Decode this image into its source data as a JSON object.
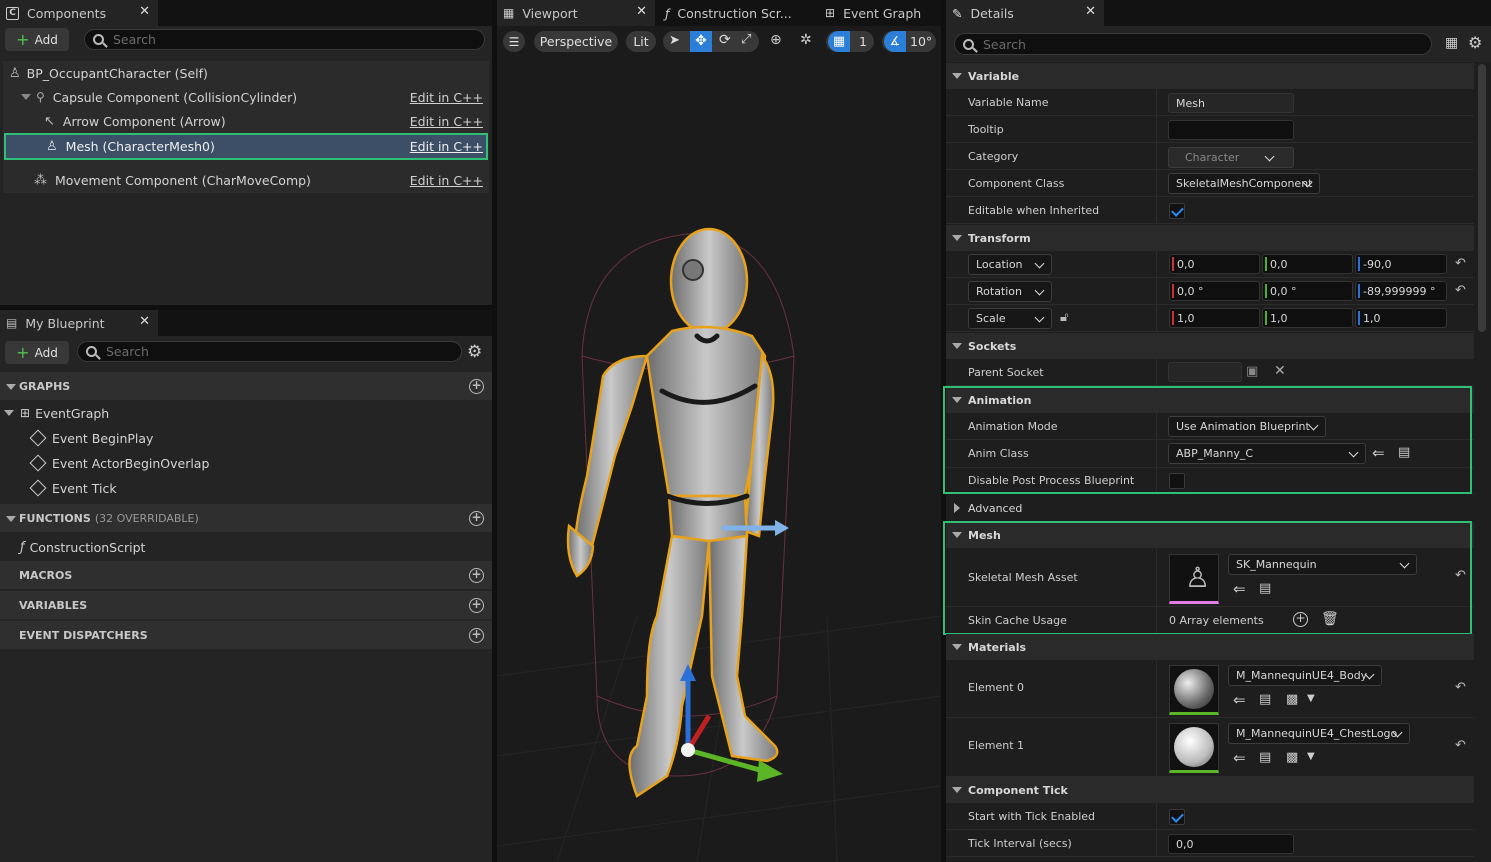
{
  "components_panel": {
    "tab_label": "Components",
    "add_label": "Add",
    "search_placeholder": "Search",
    "tree": [
      {
        "label": "BP_OccupantCharacter (Self)",
        "edit": ""
      },
      {
        "label": "Capsule Component (CollisionCylinder)",
        "edit": "Edit in C++"
      },
      {
        "label": "Arrow Component (Arrow)",
        "edit": "Edit in C++"
      },
      {
        "label": "Mesh (CharacterMesh0)",
        "edit": "Edit in C++"
      },
      {
        "label": "Movement Component (CharMoveComp)",
        "edit": "Edit in C++"
      }
    ]
  },
  "my_blueprint": {
    "tab_label": "My Blueprint",
    "add_label": "Add",
    "search_placeholder": "Search",
    "graphs_label": "GRAPHS",
    "event_graph": "EventGraph",
    "events": [
      "Event BeginPlay",
      "Event ActorBeginOverlap",
      "Event Tick"
    ],
    "functions_label": "FUNCTIONS",
    "functions_count": "(32 OVERRIDABLE)",
    "construction_script": "ConstructionScript",
    "macros_label": "MACROS",
    "variables_label": "VARIABLES",
    "dispatchers_label": "EVENT DISPATCHERS"
  },
  "center_tabs": {
    "viewport": "Viewport",
    "construction": "Construction Scr...",
    "event_graph": "Event Graph"
  },
  "viewport_toolbar": {
    "perspective": "Perspective",
    "lit": "Lit",
    "grid_value": "1",
    "angle_value": "10°"
  },
  "details": {
    "tab_label": "Details",
    "search_placeholder": "Search",
    "sections": {
      "variable": "Variable",
      "transform": "Transform",
      "sockets": "Sockets",
      "animation": "Animation",
      "advanced": "Advanced",
      "mesh": "Mesh",
      "materials": "Materials",
      "component_tick": "Component Tick"
    },
    "variable_name_label": "Variable Name",
    "variable_name_value": "Mesh",
    "tooltip_label": "Tooltip",
    "category_label": "Category",
    "category_value": "Character",
    "component_class_label": "Component Class",
    "component_class_value": "SkeletalMeshComponent",
    "editable_label": "Editable when Inherited",
    "location_label": "Location",
    "location": [
      "0,0",
      "0,0",
      "-90,0"
    ],
    "rotation_label": "Rotation",
    "rotation": [
      "0,0 °",
      "0,0 °",
      "-89,999999 °"
    ],
    "scale_label": "Scale",
    "scale": [
      "1,0",
      "1,0",
      "1,0"
    ],
    "parent_socket_label": "Parent Socket",
    "anim_mode_label": "Animation Mode",
    "anim_mode_value": "Use Animation Blueprint",
    "anim_class_label": "Anim Class",
    "anim_class_value": "ABP_Manny_C",
    "disable_pp_label": "Disable Post Process Blueprint",
    "skeletal_mesh_label": "Skeletal Mesh Asset",
    "skeletal_mesh_value": "SK_Mannequin",
    "skin_cache_label": "Skin Cache Usage",
    "skin_cache_value": "0 Array elements",
    "element0_label": "Element 0",
    "element0_value": "M_MannequinUE4_Body",
    "element1_label": "Element 1",
    "element1_value": "M_MannequinUE4_ChestLogo",
    "start_tick_label": "Start with Tick Enabled",
    "tick_interval_label": "Tick Interval (secs)",
    "tick_interval_value": "0,0"
  },
  "colors": {
    "highlight_green": "#2fbf76",
    "selection_blue": "#3d4f66",
    "accent_blue": "#2b8cf0",
    "mesh_outline": "#e8a21a"
  }
}
